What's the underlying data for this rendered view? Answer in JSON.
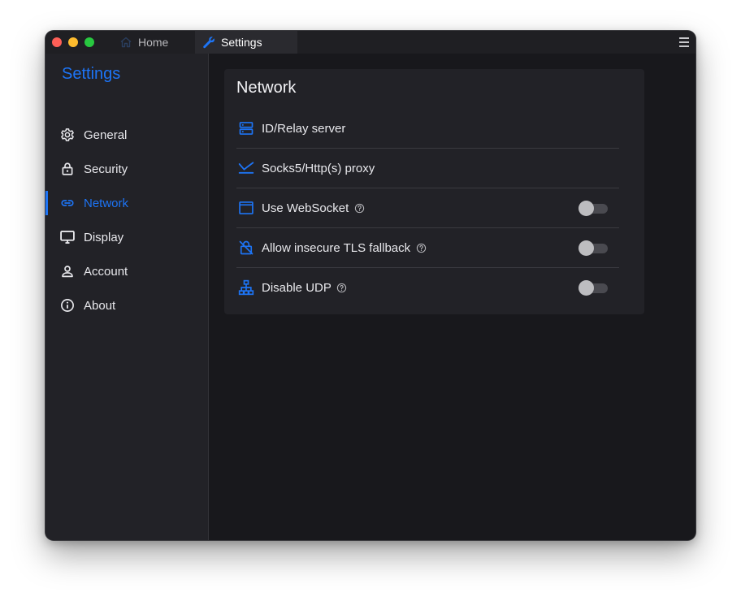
{
  "window": {
    "tabs": [
      {
        "label": "Home",
        "icon": "home-icon",
        "active": false
      },
      {
        "label": "Settings",
        "icon": "wrench-icon",
        "active": true
      }
    ]
  },
  "sidebar": {
    "title": "Settings",
    "items": [
      {
        "label": "General",
        "icon": "gear-icon",
        "active": false
      },
      {
        "label": "Security",
        "icon": "lock-icon",
        "active": false
      },
      {
        "label": "Network",
        "icon": "link-icon",
        "active": true
      },
      {
        "label": "Display",
        "icon": "monitor-icon",
        "active": false
      },
      {
        "label": "Account",
        "icon": "person-icon",
        "active": false
      },
      {
        "label": "About",
        "icon": "info-icon",
        "active": false
      }
    ]
  },
  "main": {
    "section_title": "Network",
    "rows": [
      {
        "label": "ID/Relay server",
        "icon": "server-icon",
        "has_help": false,
        "has_toggle": false
      },
      {
        "label": "Socks5/Http(s) proxy",
        "icon": "proxy-icon",
        "has_help": false,
        "has_toggle": false
      },
      {
        "label": "Use WebSocket",
        "icon": "window-icon",
        "has_help": true,
        "has_toggle": true,
        "toggle_on": false
      },
      {
        "label": "Allow insecure TLS fallback",
        "icon": "lock-off-icon",
        "has_help": true,
        "has_toggle": true,
        "toggle_on": false
      },
      {
        "label": "Disable UDP",
        "icon": "network-tree-icon",
        "has_help": true,
        "has_toggle": true,
        "toggle_on": false
      }
    ]
  },
  "colors": {
    "accent": "#1d74f5",
    "window_bg": "#18181c",
    "sidebar_bg": "#222227",
    "card_bg": "#222227",
    "text": "#e8e8ec"
  }
}
